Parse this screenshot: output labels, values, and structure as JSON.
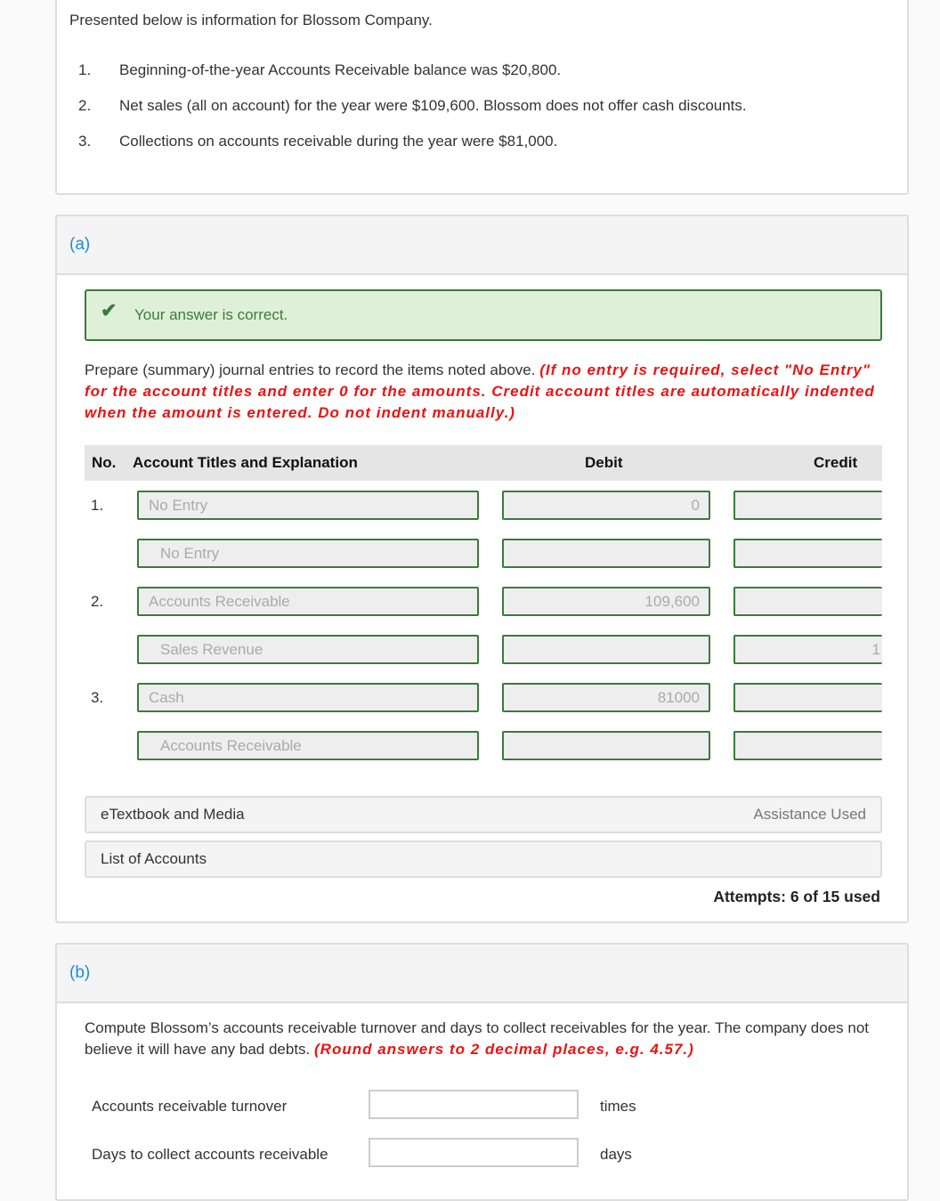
{
  "intro": "Presented below is information for Blossom Company.",
  "items": [
    {
      "n": "1.",
      "text": "Beginning-of-the-year Accounts Receivable balance was $20,800."
    },
    {
      "n": "2.",
      "text": "Net sales (all on account) for the year were $109,600. Blossom does not offer cash discounts."
    },
    {
      "n": "3.",
      "text": "Collections on accounts receivable during the year were $81,000."
    }
  ],
  "part_a": {
    "label": "(a)",
    "feedback": "Your answer is correct.",
    "feedback_icon": "check-icon",
    "instructions": "Prepare (summary) journal entries to record the items noted above.",
    "instructions_red": "(If no entry is required, select \"No Entry\" for the account titles and enter 0 for the amounts. Credit account titles are automatically indented when the amount is entered. Do not indent manually.)",
    "table": {
      "headers": {
        "no": "No.",
        "account": "Account Titles and Explanation",
        "debit": "Debit",
        "credit": "Credit"
      },
      "rows": [
        {
          "no": "1.",
          "account": "No Entry",
          "debit": "0",
          "credit": ""
        },
        {
          "no": "",
          "account": "No Entry",
          "debit": "",
          "credit": ""
        },
        {
          "no": "2.",
          "account": "Accounts Receivable",
          "debit": "109,600",
          "credit": ""
        },
        {
          "no": "",
          "account": "Sales Revenue",
          "debit": "",
          "credit": "1"
        },
        {
          "no": "3.",
          "account": "Cash",
          "debit": "81000",
          "credit": ""
        },
        {
          "no": "",
          "account": "Accounts Receivable",
          "debit": "",
          "credit": ""
        }
      ]
    },
    "etextbook": "eTextbook and Media",
    "assistance": "Assistance Used",
    "list_accounts": "List of Accounts",
    "attempts": "Attempts: 6 of 15 used"
  },
  "part_b": {
    "label": "(b)",
    "instructions": "Compute Blossom’s accounts receivable turnover and days to collect receivables for the year. The company does not believe it will have any bad debts.",
    "instructions_red": "(Round answers to 2 decimal places, e.g. 4.57.)",
    "fields": [
      {
        "label": "Accounts receivable turnover",
        "value": "",
        "unit": "times"
      },
      {
        "label": "Days to collect accounts receivable",
        "value": "",
        "unit": "days"
      }
    ]
  },
  "colors": {
    "accent": "#1a8ed8",
    "correct_border": "#3c7a3c",
    "correct_bg": "#dff0d8",
    "red": "#ee1111"
  }
}
